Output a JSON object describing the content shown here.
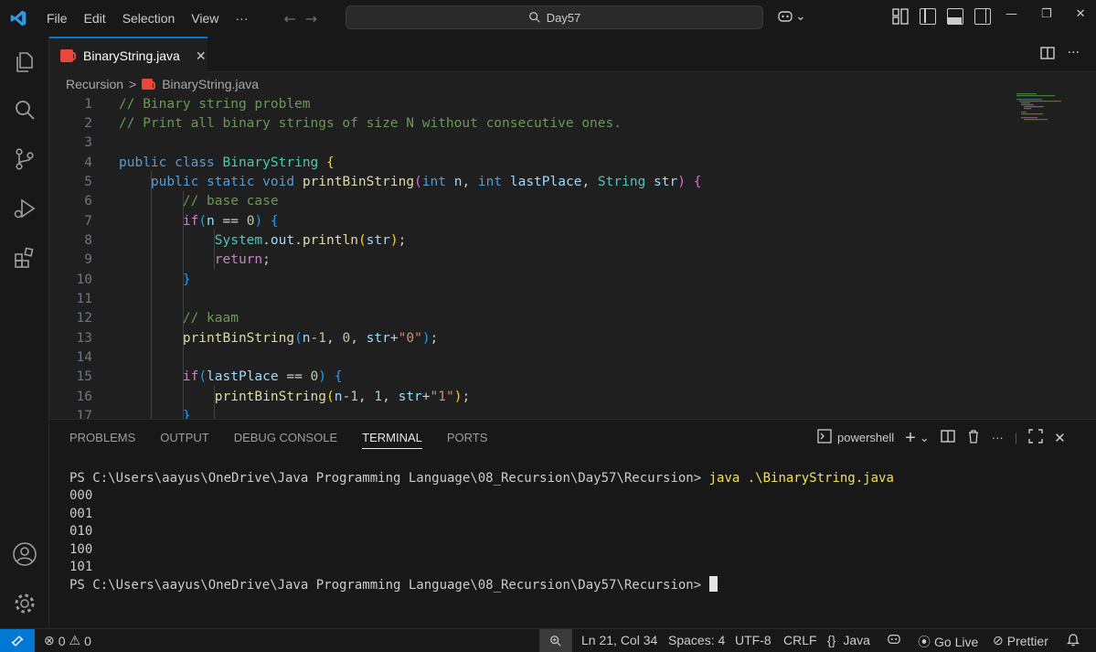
{
  "menu": [
    "File",
    "Edit",
    "Selection",
    "View",
    "···"
  ],
  "search": {
    "text": "Day57"
  },
  "tab": {
    "filename": "BinaryString.java",
    "close": "✕"
  },
  "breadcrumb": {
    "folder": "Recursion",
    "sep": ">",
    "file": "BinaryString.java"
  },
  "code_lines": [
    "1",
    "2",
    "3",
    "4",
    "5",
    "6",
    "7",
    "8",
    "9",
    "10",
    "11",
    "12",
    "13",
    "14",
    "15",
    "16",
    "17"
  ],
  "panel": {
    "tabs": [
      "PROBLEMS",
      "OUTPUT",
      "DEBUG CONSOLE",
      "TERMINAL",
      "PORTS"
    ],
    "shell": "powershell"
  },
  "terminal": {
    "prompt": "PS C:\\Users\\aayus\\OneDrive\\Java Programming Language\\08_Recursion\\Day57\\Recursion> ",
    "command": "java .\\BinaryString.java",
    "output": [
      "000",
      "001",
      "010",
      "100",
      "101"
    ]
  },
  "status": {
    "errors": "0",
    "warnings": "0",
    "position": "Ln 21, Col 34",
    "spaces": "Spaces: 4",
    "encoding": "UTF-8",
    "eol": "CRLF",
    "language": "Java",
    "golive": "Go Live",
    "prettier": "Prettier"
  },
  "colors": {
    "accent": "#0078d4",
    "background": "#1f1f1f",
    "chrome": "#181818"
  }
}
